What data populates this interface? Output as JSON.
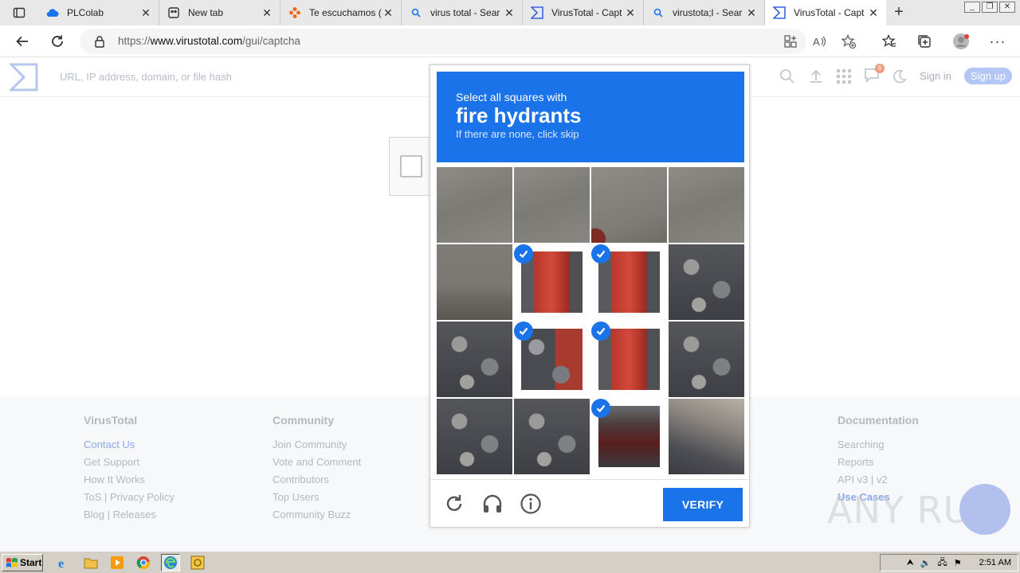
{
  "browser": {
    "tabs": [
      {
        "title": "PLColab",
        "favicon": "cloud-icon",
        "active": false
      },
      {
        "title": "New tab",
        "favicon": "new-tab-icon",
        "active": false
      },
      {
        "title": "Te escuchamos (",
        "favicon": "orange-flower-icon",
        "active": false
      },
      {
        "title": "virus total - Sear",
        "favicon": "search-icon",
        "active": false
      },
      {
        "title": "VirusTotal - Capt",
        "favicon": "virustotal-icon",
        "active": false
      },
      {
        "title": "virustota;l - Sear",
        "favicon": "search-icon",
        "active": false
      },
      {
        "title": "VirusTotal - Capt",
        "favicon": "virustotal-icon",
        "active": true
      }
    ],
    "url_prefix": "https://",
    "url_host": "www.virustotal.com",
    "url_path": "/gui/captcha"
  },
  "vt_header": {
    "search_placeholder": "URL, IP address, domain, or file hash",
    "notification_count": "6",
    "sign_in": "Sign in",
    "sign_up": "Sign up"
  },
  "captcha": {
    "instruction": "Select all squares with",
    "target": "fire hydrants",
    "hint": "If there are none, click skip",
    "verify_label": "VERIFY",
    "tiles": [
      {
        "selected": false,
        "kind": "road"
      },
      {
        "selected": false,
        "kind": "road"
      },
      {
        "selected": false,
        "kind": "road-hydrant-top"
      },
      {
        "selected": false,
        "kind": "road"
      },
      {
        "selected": false,
        "kind": "road-gravel"
      },
      {
        "selected": true,
        "kind": "hydrant"
      },
      {
        "selected": true,
        "kind": "hydrant"
      },
      {
        "selected": false,
        "kind": "gravel"
      },
      {
        "selected": false,
        "kind": "gravel"
      },
      {
        "selected": true,
        "kind": "hydrant-gravel"
      },
      {
        "selected": true,
        "kind": "hydrant"
      },
      {
        "selected": false,
        "kind": "gravel"
      },
      {
        "selected": false,
        "kind": "gravel"
      },
      {
        "selected": false,
        "kind": "gravel"
      },
      {
        "selected": true,
        "kind": "hydrant-dark"
      },
      {
        "selected": false,
        "kind": "gravel-rock"
      }
    ]
  },
  "footer": {
    "columns": [
      {
        "heading": "VirusTotal",
        "links": [
          "Contact Us",
          "Get Support",
          "How It Works",
          "ToS | Privacy Policy",
          "Blog | Releases"
        ]
      },
      {
        "heading": "Community",
        "links": [
          "Join Community",
          "Vote and Comment",
          "Contributors",
          "Top Users",
          "Community Buzz"
        ]
      },
      {
        "heading": "Documentation",
        "links": [
          "Searching",
          "Reports",
          "API v3 | v2",
          "Use Cases"
        ]
      }
    ]
  },
  "watermark": "ANY RUN",
  "taskbar": {
    "start_label": "Start",
    "clock": "2:51 AM"
  },
  "colors": {
    "captcha_blue": "#1a73e8",
    "vt_blue": "#8ba7ee"
  }
}
